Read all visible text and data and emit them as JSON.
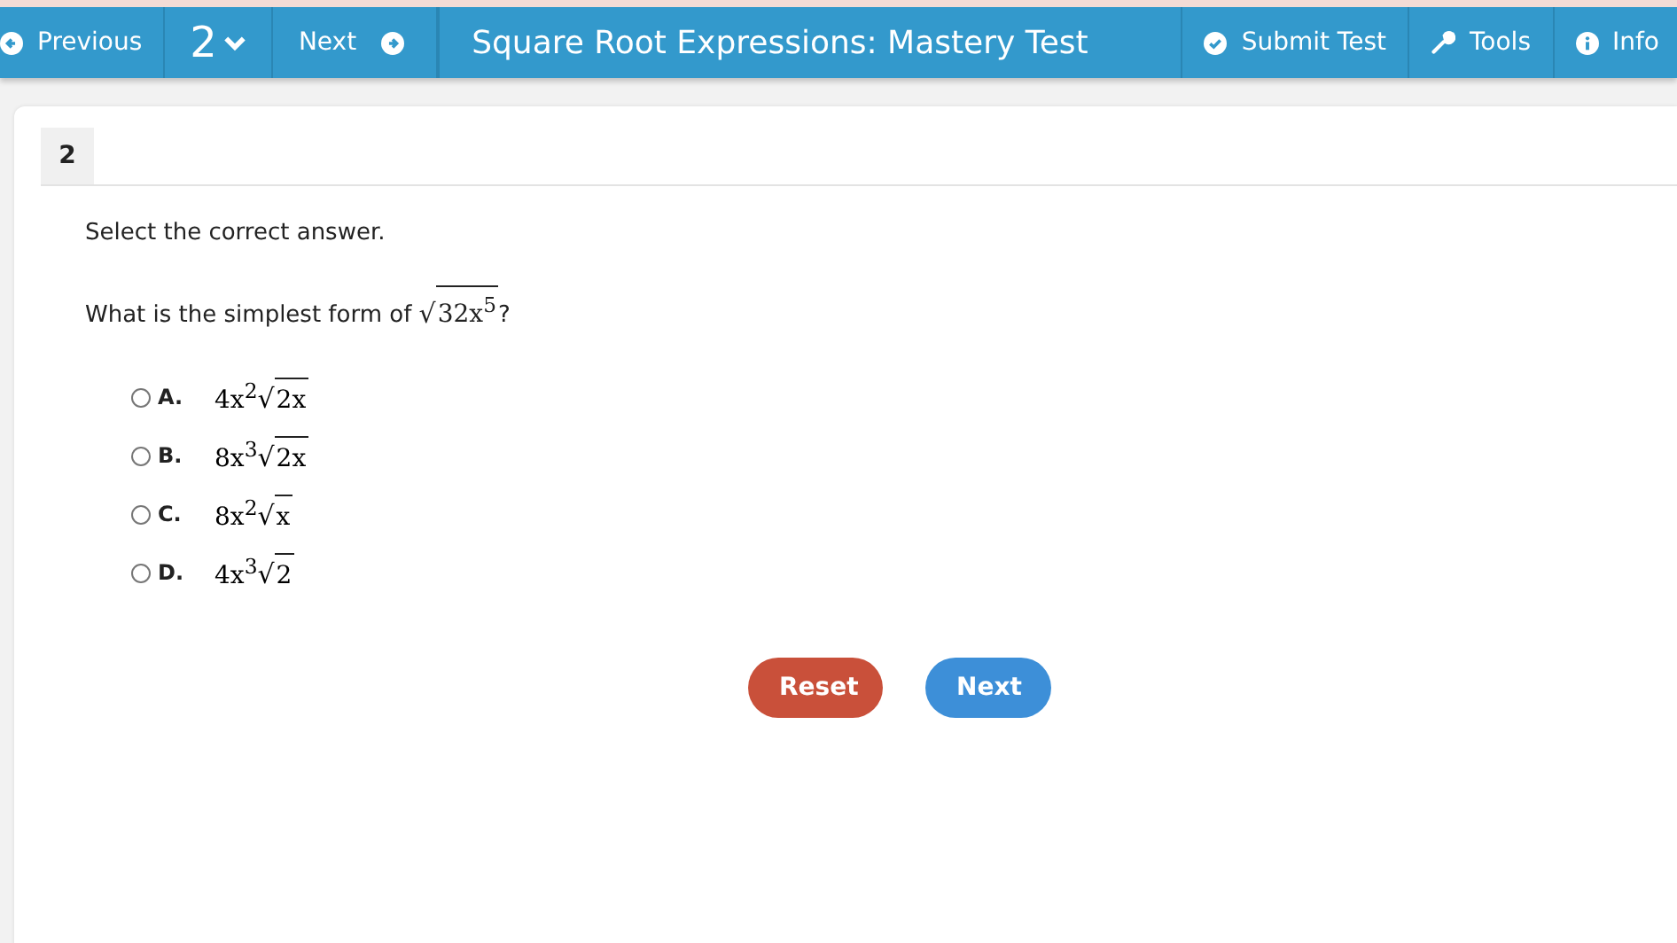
{
  "toolbar": {
    "previous": "Previous",
    "question_number": "2",
    "next": "Next",
    "title": "Square Root Expressions: Mastery Test",
    "submit": "Submit Test",
    "tools": "Tools",
    "info": "Info"
  },
  "question": {
    "number": "2",
    "instruction": "Select the correct answer.",
    "prompt": "What is the simplest form of ",
    "radical": "√",
    "radicand": "32x$^{5}$",
    "prompt_end": "?",
    "options": [
      {
        "letter": "A.",
        "lead": "4x$^{2}$",
        "radical": "√",
        "radicand": "2x",
        "selected": false
      },
      {
        "letter": "B.",
        "lead": "8x$^{3}$",
        "radical": "√",
        "radicand": "2x",
        "selected": false
      },
      {
        "letter": "C.",
        "lead": "8x$^{2}$",
        "radical": "√",
        "radicand": "x",
        "selected": false
      },
      {
        "letter": "D.",
        "lead": "4x$^{3}$",
        "radical": "√",
        "radicand": "2",
        "selected": false
      }
    ]
  },
  "buttons": {
    "reset": "Reset",
    "next": "Next"
  }
}
